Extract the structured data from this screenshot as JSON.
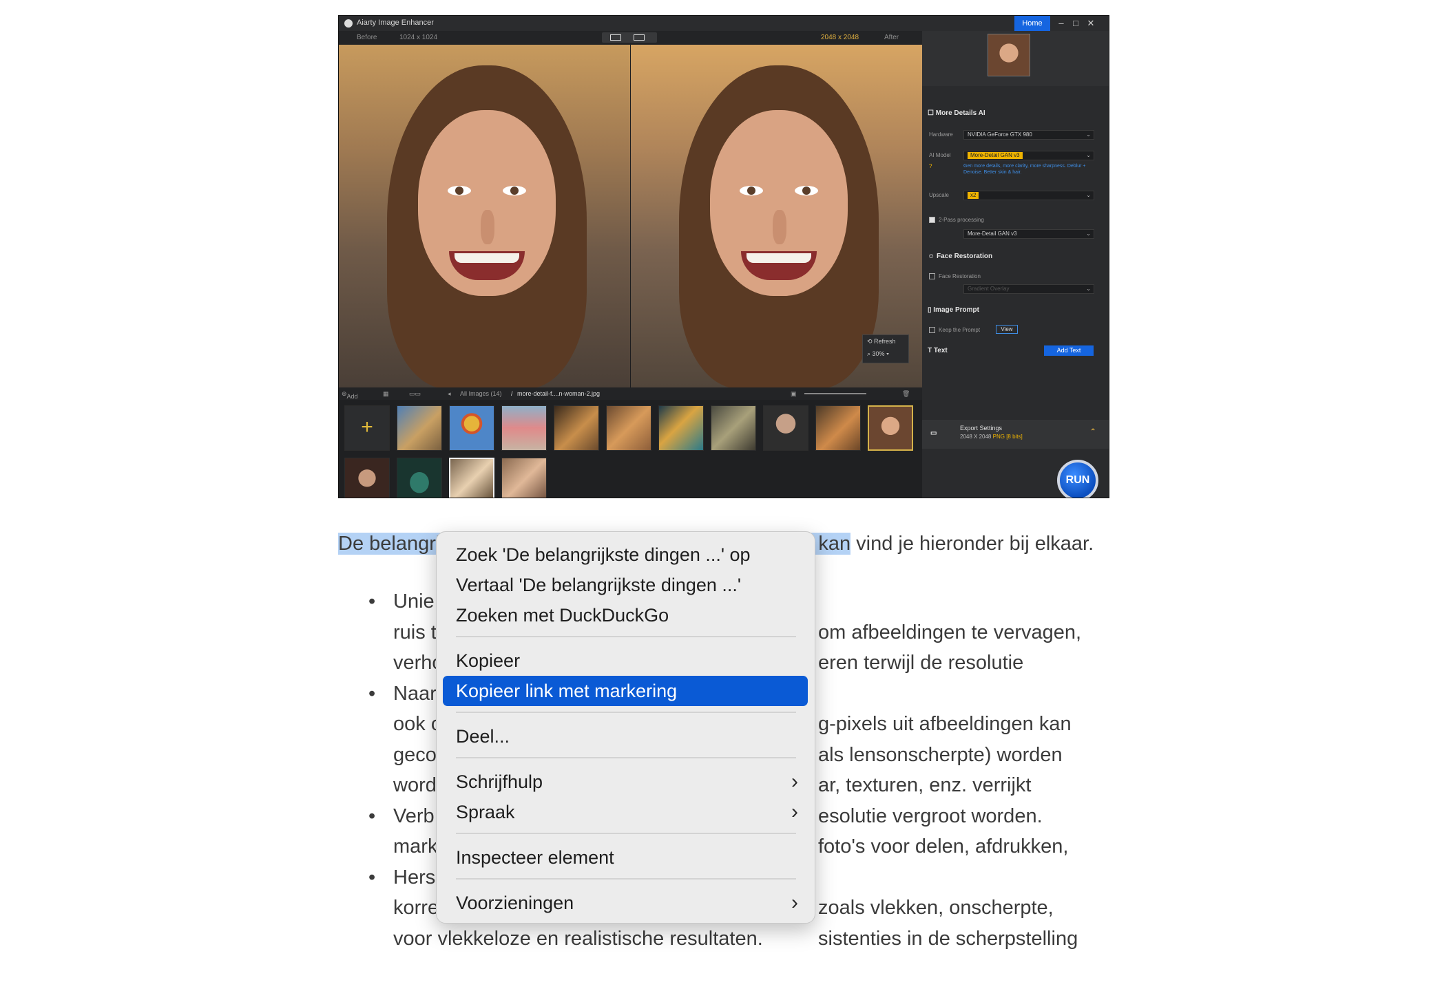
{
  "app": {
    "title": "Aiarty Image Enhancer",
    "home_tab": "Home",
    "window_controls": [
      "minimize-icon",
      "maximize-icon",
      "close-icon"
    ],
    "before_label": "Before",
    "before_res": "1024 x 1024",
    "after_res": "2048 x 2048",
    "after_label": "After",
    "refresh_label": "Refresh",
    "zoom": "30%",
    "strip": {
      "add_label": "Add",
      "breadcrumb_root": "All Images (14)",
      "breadcrumb_sep": "/",
      "breadcrumb_file": "more-detail-f....n-woman-2.jpg"
    },
    "sidebar": {
      "more_details_title": "More Details AI",
      "hardware_label": "Hardware",
      "hardware_value": "NVIDIA GeForce GTX 980",
      "ai_model_label": "AI Model",
      "ai_model_value": "More-Detail GAN  v3",
      "ai_model_hint": "Gen more details, more clarity, more sharpness. Deblur + Denoise. Better skin & hair.",
      "upscale_label": "Upscale",
      "upscale_value": "x2",
      "two_pass_label": "2-Pass processing",
      "two_pass_value": "More-Detail GAN  v3",
      "face_restoration_title": "Face Restoration",
      "face_restoration_label": "Face Restoration",
      "face_restoration_value": "Gradient Overlay",
      "image_prompt_title": "Image Prompt",
      "keep_prompt_label": "Keep the Prompt",
      "view_label": "View",
      "text_title": "Text",
      "add_text_label": "Add Text",
      "export_title": "Export Settings",
      "export_size": "2048 X 2048",
      "export_format": "PNG",
      "export_bits": "[8 bits]",
      "run_label": "RUN"
    }
  },
  "article": {
    "para_selected_start": "De belangri",
    "para_selected_end": "kan",
    "para_rest": " vind je hieronder bij elkaar.",
    "bullets": [
      {
        "lines": [
          "Unie",
          "ruis t",
          "verho"
        ],
        "right": [
          "om afbeeldingen te vervagen,",
          "eren terwijl de resolutie",
          ""
        ]
      },
      {
        "lines": [
          "Naar",
          "ook c",
          "geco",
          "word"
        ],
        "right": [
          "g-pixels uit afbeeldingen kan",
          "als lensonscherpte) worden",
          "ar, texturen, enz. verrijkt",
          "esolutie vergroot worden."
        ]
      },
      {
        "lines": [
          "Verb",
          "mark"
        ],
        "right": [
          "foto's voor delen, afdrukken,",
          ""
        ]
      },
      {
        "lines": [
          "Hers",
          "korre",
          "voor vlekkeloze en realistische resultaten."
        ],
        "right": [
          "zoals vlekken, onscherpte,",
          "sistenties in de scherpstelling",
          ""
        ]
      }
    ]
  },
  "context_menu": {
    "items": [
      {
        "label": "Zoek 'De belangrijkste dingen ...' op"
      },
      {
        "label": "Vertaal 'De belangrijkste dingen ...'"
      },
      {
        "label": "Zoeken met DuckDuckGo"
      },
      {
        "label": "Kopieer"
      },
      {
        "label": "Kopieer link met markering",
        "highlighted": true
      },
      {
        "label": "Deel..."
      },
      {
        "label": "Schrijfhulp",
        "submenu": true
      },
      {
        "label": "Spraak",
        "submenu": true
      },
      {
        "label": "Inspecteer element"
      },
      {
        "label": "Voorzieningen",
        "submenu": true
      }
    ]
  },
  "colors": {
    "selection": "#b4d2f5",
    "menu_highlight": "#0a5ad5",
    "app_accent": "#1565e0",
    "app_yellow": "#f0b400"
  }
}
